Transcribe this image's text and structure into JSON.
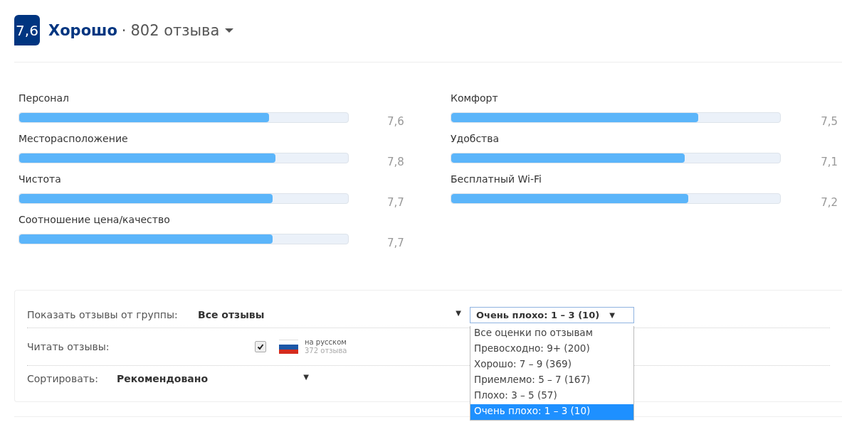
{
  "header": {
    "score": "7,6",
    "rating_word": "Хорошо",
    "separator": "·",
    "review_count": "802 отзыва"
  },
  "categories_left": [
    {
      "name": "Персонал",
      "level": 0.76,
      "reading": "7,6"
    },
    {
      "name": "Месторасположение",
      "level": 0.78,
      "reading": "7,8"
    },
    {
      "name": "Чистота",
      "level": 0.77,
      "reading": "7,7"
    },
    {
      "name": "Соотношение цена/качество",
      "level": 0.77,
      "reading": "7,7"
    }
  ],
  "categories_right": [
    {
      "name": "Комфорт",
      "level": 0.75,
      "reading": "7,5"
    },
    {
      "name": "Удобства",
      "level": 0.71,
      "reading": "7,1"
    },
    {
      "name": "Бесплатный Wi-Fi",
      "level": 0.72,
      "reading": "7,2"
    }
  ],
  "filters": {
    "group_label": "Показать отзывы от группы:",
    "group_value": "Все отзывы",
    "group_arrow": "▼",
    "score_value": "Очень плохо: 1 – 3 (10)",
    "score_arrow": "▼",
    "score_expanded": true,
    "score_options": [
      {
        "label": "Все оценки по отзывам",
        "selected": false
      },
      {
        "label": "Превосходно: 9+ (200)",
        "selected": false
      },
      {
        "label": "Хорошо: 7 – 9 (369)",
        "selected": false
      },
      {
        "label": "Приемлемо: 5 – 7 (167)",
        "selected": false
      },
      {
        "label": "Плохо: 3 – 5 (57)",
        "selected": false
      },
      {
        "label": "Очень плохо: 1 – 3 (10)",
        "selected": true
      }
    ],
    "read_label": "Читать отзывы:",
    "languages": [
      {
        "checked": true,
        "name": "на русском",
        "count": "372 отзыва"
      }
    ],
    "sort_label": "Сортировать:",
    "sort_value": "Рекомендовано",
    "sort_arrow": "▼"
  }
}
